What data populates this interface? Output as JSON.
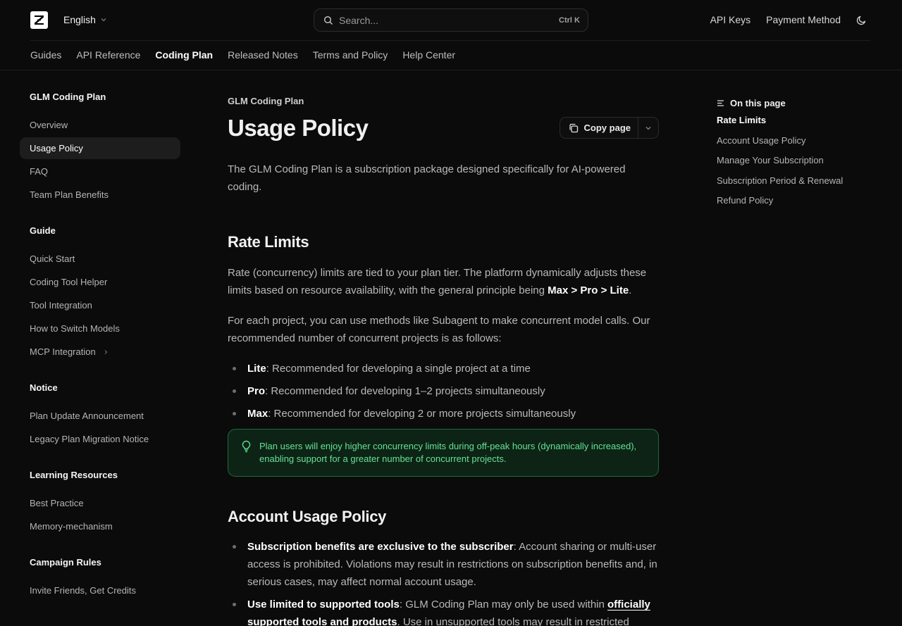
{
  "header": {
    "language": "English",
    "search": {
      "placeholder": "Search...",
      "shortcut": "Ctrl K"
    },
    "links": [
      "API Keys",
      "Payment Method"
    ]
  },
  "tabs": [
    {
      "label": "Guides",
      "active": false
    },
    {
      "label": "API Reference",
      "active": false
    },
    {
      "label": "Coding Plan",
      "active": true
    },
    {
      "label": "Released Notes",
      "active": false
    },
    {
      "label": "Terms and Policy",
      "active": false
    },
    {
      "label": "Help Center",
      "active": false
    }
  ],
  "sidebar": [
    {
      "title": "GLM Coding Plan",
      "items": [
        "Overview",
        "Usage Policy",
        "FAQ",
        "Team Plan Benefits"
      ]
    },
    {
      "title": "Guide",
      "items": [
        "Quick Start",
        "Coding Tool Helper",
        "Tool Integration",
        "How to Switch Models",
        "MCP Integration"
      ]
    },
    {
      "title": "Notice",
      "items": [
        "Plan Update Announcement",
        "Legacy Plan Migration Notice"
      ]
    },
    {
      "title": "Learning Resources",
      "items": [
        "Best Practice",
        "Memory-mechanism"
      ]
    },
    {
      "title": "Campaign Rules",
      "items": [
        "Invite Friends, Get Credits"
      ]
    }
  ],
  "sidebar_active": "Usage Policy",
  "page": {
    "eyebrow": "GLM Coding Plan",
    "title": "Usage Policy",
    "copy_label": "Copy page",
    "intro": "The GLM Coding Plan is a subscription package designed specifically for AI-powered coding."
  },
  "rate_limits": {
    "heading": "Rate Limits",
    "p1_text": "Rate (concurrency) limits are tied to your plan tier. The platform dynamically adjusts these limits based on resource availability, with the general principle being ",
    "p1_bold": "Max > Pro > Lite",
    "p1_end": ".",
    "p2": "For each project, you can use methods like Subagent to make concurrent model calls. Our recommended number of concurrent projects is as follows:",
    "bullets": [
      {
        "term": "Lite",
        "text": ": Recommended for developing a single project at a time"
      },
      {
        "term": "Pro",
        "text": ": Recommended for developing 1–2 projects simultaneously"
      },
      {
        "term": "Max",
        "text": ": Recommended for developing 2 or more projects simultaneously"
      }
    ],
    "note": "Plan users will enjoy higher concurrency limits during off-peak hours (dynamically increased), enabling support for a greater number of concurrent projects."
  },
  "account_policy": {
    "heading": "Account Usage Policy",
    "b1_term": "Subscription benefits are exclusive to the subscriber",
    "b1_text": ": Account sharing or multi-user access is prohibited. Violations may result in restrictions on subscription benefits and, in serious cases, may affect normal account usage.",
    "b2_term": "Use limited to supported tools",
    "b2_text": ": GLM Coding Plan may only be used within ",
    "b2_link": "officially supported tools and products",
    "b2_end": ". Use in unsupported tools may result in restricted"
  },
  "toc": {
    "heading": "On this page",
    "items": [
      "Rate Limits",
      "Account Usage Policy",
      "Manage Your Subscription",
      "Subscription Period & Renewal",
      "Refund Policy"
    ],
    "active": "Rate Limits"
  },
  "colors": {
    "background": "#0b0b0b",
    "note_bg": "#0d2316",
    "note_border": "#1f6b3d",
    "note_text": "#65e293"
  }
}
